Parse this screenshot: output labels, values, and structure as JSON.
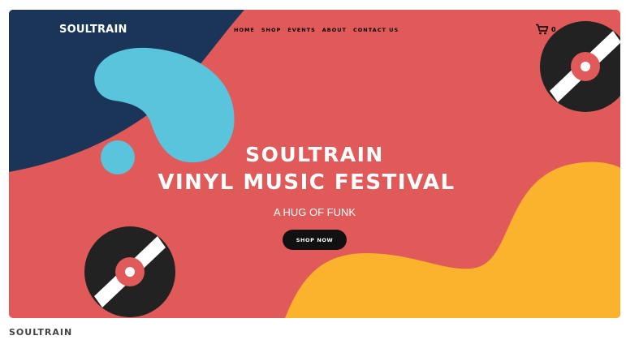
{
  "header": {
    "brand": "SOULTRAIN",
    "nav": [
      "HOME",
      "SHOP",
      "EVENTS",
      "ABOUT",
      "CONTACT US"
    ],
    "cart_count": "0"
  },
  "hero": {
    "title_line1": "SOULTRAIN",
    "title_line2": "VINYL MUSIC FESTIVAL",
    "subtitle": "A HUG OF FUNK",
    "button_label": "SHOP NOW"
  },
  "footer": {
    "site_title": "SOULTRAIN"
  },
  "colors": {
    "background_red": "#e05a59",
    "navy": "#1a3558",
    "blue_blob": "#59c4dc",
    "yellow": "#fbb22c",
    "record": "#222222",
    "button": "#111111"
  },
  "icons": [
    "cart-icon",
    "vinyl-record-icon"
  ]
}
